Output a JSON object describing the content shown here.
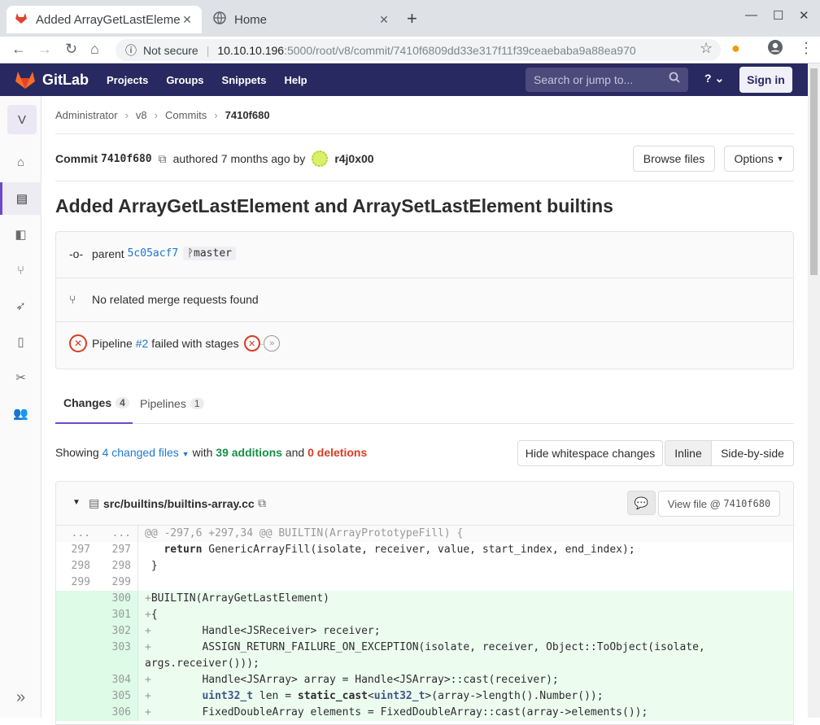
{
  "browser": {
    "tabs": [
      {
        "title": "Added ArrayGetLastEleme",
        "active": true
      },
      {
        "title": "Home",
        "active": false
      }
    ],
    "security": "Not secure",
    "url_host": "10.10.10.196",
    "url_path": ":5000/root/v8/commit/7410f6809dd33e317f11f39ceaebaba9a88ea970"
  },
  "gitlab": {
    "brand": "GitLab",
    "nav": [
      "Projects",
      "Groups",
      "Snippets",
      "Help"
    ],
    "search_placeholder": "Search or jump to...",
    "signin": "Sign in"
  },
  "sidebar": {
    "project_letter": "V"
  },
  "breadcrumb": [
    "Administrator",
    "v8",
    "Commits",
    "7410f680"
  ],
  "commit": {
    "label": "Commit",
    "sha_short": "7410f680",
    "authored": "authored 7 months ago by",
    "author": "r4j0x00",
    "browse_files": "Browse files",
    "options": "Options",
    "title": "Added ArrayGetLastElement and ArraySetLastElement builtins",
    "parent_label": "parent",
    "parent_sha": "5c05acf7",
    "branch": "master",
    "merge_requests": "No related merge requests found",
    "pipeline_prefix": "Pipeline",
    "pipeline_id": "#2",
    "pipeline_suffix": "failed with stages"
  },
  "tabs": [
    {
      "label": "Changes",
      "count": "4"
    },
    {
      "label": "Pipelines",
      "count": "1"
    }
  ],
  "summary": {
    "showing": "Showing",
    "changed_files": "4 changed files",
    "with": "with",
    "additions": "39 additions",
    "and": "and",
    "deletions": "0 deletions",
    "hide_ws": "Hide whitespace changes",
    "inline": "Inline",
    "side_by_side": "Side-by-side"
  },
  "file": {
    "path": "src/builtins/builtins-array.cc",
    "view_file": "View file @",
    "view_sha": "7410f680"
  },
  "diff": [
    {
      "t": "hunk",
      "o": "...",
      "n": "...",
      "code": "@@ -297,6 +297,34 @@ BUILTIN(ArrayPrototypeFill) {"
    },
    {
      "t": "ctx",
      "o": "297",
      "n": "297",
      "code": "  return GenericArrayFill(isolate, receiver, value, start_index, end_index);"
    },
    {
      "t": "ctx",
      "o": "298",
      "n": "298",
      "code": "}"
    },
    {
      "t": "ctx",
      "o": "299",
      "n": "299",
      "code": ""
    },
    {
      "t": "add",
      "o": "",
      "n": "300",
      "code": "BUILTIN(ArrayGetLastElement)"
    },
    {
      "t": "add",
      "o": "",
      "n": "301",
      "code": "{"
    },
    {
      "t": "add",
      "o": "",
      "n": "302",
      "code": "        Handle<JSReceiver> receiver;"
    },
    {
      "t": "add",
      "o": "",
      "n": "303",
      "code": "        ASSIGN_RETURN_FAILURE_ON_EXCEPTION(isolate, receiver, Object::ToObject(isolate,",
      "code2": "args.receiver()));"
    },
    {
      "t": "add",
      "o": "",
      "n": "304",
      "code": "        Handle<JSArray> array = Handle<JSArray>::cast(receiver);"
    },
    {
      "t": "add",
      "o": "",
      "n": "305",
      "code": "        uint32_t len = static_cast<uint32_t>(array->length().Number());"
    },
    {
      "t": "add",
      "o": "",
      "n": "306",
      "code": "        FixedDoubleArray elements = FixedDoubleArray::cast(array->elements());"
    }
  ]
}
